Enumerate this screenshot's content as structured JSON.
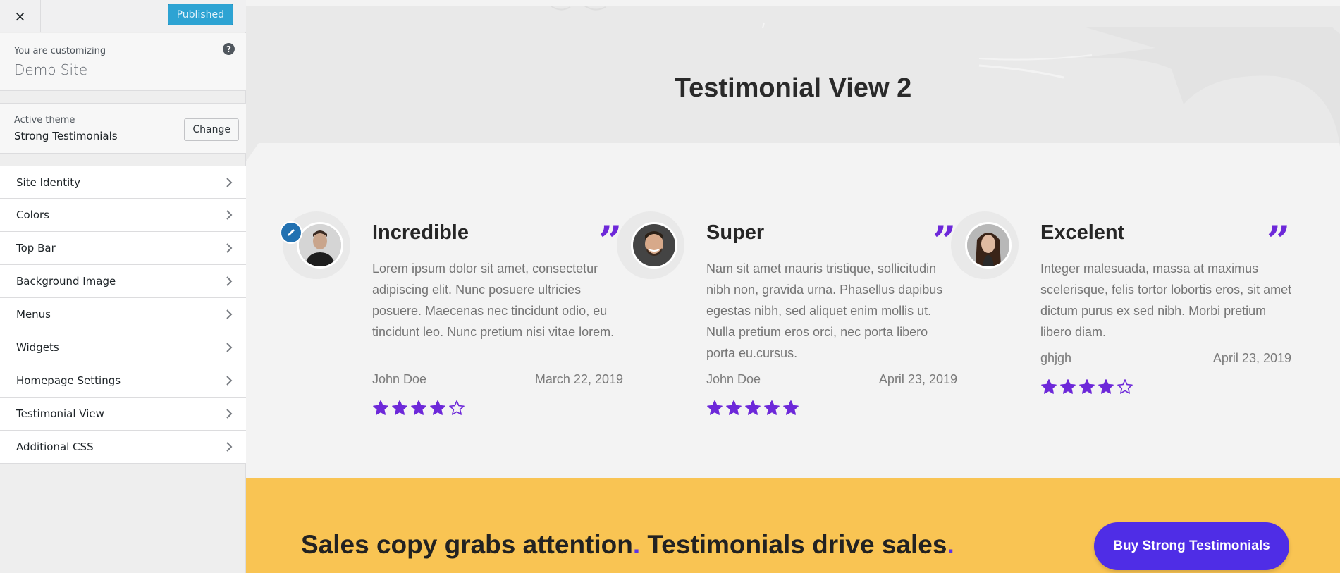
{
  "sidebar": {
    "close_icon": "×",
    "publish_label": "Published",
    "customizing_label": "You are customizing",
    "site_name": "Demo Site",
    "help_icon": "?",
    "theme_label": "Active theme",
    "theme_name": "Strong Testimonials",
    "change_label": "Change",
    "items": [
      {
        "label": "Site Identity"
      },
      {
        "label": "Colors"
      },
      {
        "label": "Top Bar"
      },
      {
        "label": "Background Image"
      },
      {
        "label": "Menus"
      },
      {
        "label": "Widgets"
      },
      {
        "label": "Homepage Settings"
      },
      {
        "label": "Testimonial View"
      },
      {
        "label": "Additional CSS"
      }
    ]
  },
  "preview": {
    "page_title": "Testimonial View 2",
    "quote_glyph": "”",
    "testimonials": [
      {
        "title": "Incredible",
        "body": "Lorem ipsum dolor sit amet, consectetur adipiscing elit. Nunc posuere ultricies posuere. Maecenas nec tincidunt odio, eu tincidunt leo. Nunc pretium nisi vitae lorem.",
        "author": "John Doe",
        "date": "March 22, 2019",
        "rating": 4
      },
      {
        "title": "Super",
        "body": "Nam sit amet mauris tristique, sollicitudin nibh non, gravida urna. Phasellus dapibus egestas nibh, sed aliquet enim mollis ut. Nulla pretium eros orci, nec porta libero porta eu.cursus.",
        "author": "John Doe",
        "date": "April 23, 2019",
        "rating": 5
      },
      {
        "title": "Excelent",
        "body": "Integer malesuada, massa at maximus scelerisque, felis tortor lobortis eros, sit amet dictum purus ex sed nibh. Morbi pretium libero diam.",
        "author": "ghjgh",
        "date": "April 23, 2019",
        "rating": 4
      }
    ],
    "cta": {
      "part1": "Sales copy grabs attention",
      "dot1": ".",
      "part2": " Testimonials drive sales",
      "dot2": ".",
      "button_label": "Buy Strong Testimonials"
    }
  },
  "colors": {
    "accent_purple": "#6d28d9",
    "cta_background": "#f9c453",
    "cta_button": "#4f2de6",
    "publish_button": "#2da3d3"
  }
}
